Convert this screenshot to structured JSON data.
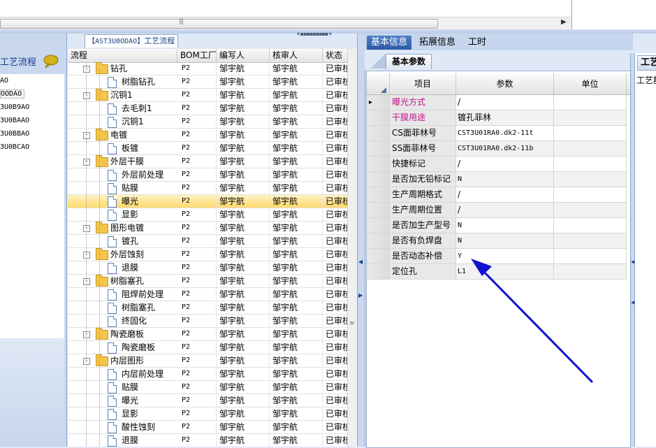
{
  "left_panel": {
    "title": "工艺流程",
    "items": [
      "AO",
      "OODAO",
      "3U0B9AO",
      "3U0BAAO",
      "3U0BBAO",
      "3U0BCAO"
    ],
    "selected_index": 1
  },
  "tree_panel": {
    "tab_code": "【AST3U0ODAO】",
    "tab_label": "工艺流程",
    "columns": [
      "流程",
      "BOM工厂",
      "编写人",
      "核审人",
      "状态"
    ],
    "rows": [
      {
        "name": "钻孔",
        "level": 0,
        "folder": true,
        "expander": "-",
        "bom": "P2",
        "writer": "邹宇航",
        "reviewer": "邹宇航",
        "status": "已审核"
      },
      {
        "name": "树脂钻孔",
        "level": 1,
        "folder": false,
        "bom": "P2",
        "writer": "邹宇航",
        "reviewer": "邹宇航",
        "status": "已审核"
      },
      {
        "name": "沉铜1",
        "level": 0,
        "folder": true,
        "expander": "-",
        "bom": "P2",
        "writer": "邹宇航",
        "reviewer": "邹宇航",
        "status": "已审核"
      },
      {
        "name": "去毛刺1",
        "level": 1,
        "folder": false,
        "bom": "P2",
        "writer": "邹宇航",
        "reviewer": "邹宇航",
        "status": "已审核"
      },
      {
        "name": "沉铜1",
        "level": 1,
        "folder": false,
        "bom": "P2",
        "writer": "邹宇航",
        "reviewer": "邹宇航",
        "status": "已审核"
      },
      {
        "name": "电镀",
        "level": 0,
        "folder": true,
        "expander": "-",
        "bom": "P2",
        "writer": "邹宇航",
        "reviewer": "邹宇航",
        "status": "已审核"
      },
      {
        "name": "板镀",
        "level": 1,
        "folder": false,
        "bom": "P2",
        "writer": "邹宇航",
        "reviewer": "邹宇航",
        "status": "已审核"
      },
      {
        "name": "外层干膜",
        "level": 0,
        "folder": true,
        "expander": "-",
        "bom": "P2",
        "writer": "邹宇航",
        "reviewer": "邹宇航",
        "status": "已审核"
      },
      {
        "name": "外层前处理",
        "level": 1,
        "folder": false,
        "bom": "P2",
        "writer": "邹宇航",
        "reviewer": "邹宇航",
        "status": "已审核"
      },
      {
        "name": "贴膜",
        "level": 1,
        "folder": false,
        "bom": "P2",
        "writer": "邹宇航",
        "reviewer": "邹宇航",
        "status": "已审核"
      },
      {
        "name": "曝光",
        "level": 1,
        "folder": false,
        "selected": true,
        "bom": "P2",
        "writer": "邹宇航",
        "reviewer": "邹宇航",
        "status": "已审核"
      },
      {
        "name": "显影",
        "level": 1,
        "folder": false,
        "bom": "P2",
        "writer": "邹宇航",
        "reviewer": "邹宇航",
        "status": "已审核"
      },
      {
        "name": "图形电镀",
        "level": 0,
        "folder": true,
        "expander": "-",
        "bom": "P2",
        "writer": "邹宇航",
        "reviewer": "邹宇航",
        "status": "已审核"
      },
      {
        "name": "镀孔",
        "level": 1,
        "folder": false,
        "bom": "P2",
        "writer": "邹宇航",
        "reviewer": "邹宇航",
        "status": "已审核"
      },
      {
        "name": "外层蚀刻",
        "level": 0,
        "folder": true,
        "expander": "-",
        "bom": "P2",
        "writer": "邹宇航",
        "reviewer": "邹宇航",
        "status": "已审核"
      },
      {
        "name": "退膜",
        "level": 1,
        "folder": false,
        "bom": "P2",
        "writer": "邹宇航",
        "reviewer": "邹宇航",
        "status": "已审核"
      },
      {
        "name": "树脂塞孔",
        "level": 0,
        "folder": true,
        "expander": "-",
        "bom": "P2",
        "writer": "邹宇航",
        "reviewer": "邹宇航",
        "status": "已审核"
      },
      {
        "name": "阻焊前处理",
        "level": 1,
        "folder": false,
        "bom": "P2",
        "writer": "邹宇航",
        "reviewer": "邹宇航",
        "status": "已审核"
      },
      {
        "name": "树脂塞孔",
        "level": 1,
        "folder": false,
        "bom": "P2",
        "writer": "邹宇航",
        "reviewer": "邹宇航",
        "status": "已审核"
      },
      {
        "name": "终固化",
        "level": 1,
        "folder": false,
        "bom": "P2",
        "writer": "邹宇航",
        "reviewer": "邹宇航",
        "status": "已审核"
      },
      {
        "name": "陶瓷磨板",
        "level": 0,
        "folder": true,
        "expander": "-",
        "bom": "P2",
        "writer": "邹宇航",
        "reviewer": "邹宇航",
        "status": "已审核"
      },
      {
        "name": "陶瓷磨板",
        "level": 1,
        "folder": false,
        "bom": "P2",
        "writer": "邹宇航",
        "reviewer": "邹宇航",
        "status": "已审核"
      },
      {
        "name": "内层图形",
        "level": 0,
        "folder": true,
        "expander": "-",
        "bom": "P2",
        "writer": "邹宇航",
        "reviewer": "邹宇航",
        "status": "已审核"
      },
      {
        "name": "内层前处理",
        "level": 1,
        "folder": false,
        "bom": "P2",
        "writer": "邹宇航",
        "reviewer": "邹宇航",
        "status": "已审核"
      },
      {
        "name": "贴膜",
        "level": 1,
        "folder": false,
        "bom": "P2",
        "writer": "邹宇航",
        "reviewer": "邹宇航",
        "status": "已审核"
      },
      {
        "name": "曝光",
        "level": 1,
        "folder": false,
        "bom": "P2",
        "writer": "邹宇航",
        "reviewer": "邹宇航",
        "status": "已审核"
      },
      {
        "name": "显影",
        "level": 1,
        "folder": false,
        "bom": "P2",
        "writer": "邹宇航",
        "reviewer": "邹宇航",
        "status": "已审核"
      },
      {
        "name": "酸性蚀刻",
        "level": 1,
        "folder": false,
        "bom": "P2",
        "writer": "邹宇航",
        "reviewer": "邹宇航",
        "status": "已审核"
      },
      {
        "name": "退膜",
        "level": 1,
        "folder": false,
        "bom": "P2",
        "writer": "邹宇航",
        "reviewer": "邹宇航",
        "status": "已审核"
      }
    ]
  },
  "info_panel": {
    "tabs": [
      "基本信息",
      "拓展信息",
      "工时"
    ],
    "active_tab": 0,
    "subtab": "基本参数",
    "columns": [
      "项目",
      "参数",
      "单位"
    ],
    "rows": [
      {
        "key": "曝光方式",
        "value": "/",
        "unit": "",
        "pink": true,
        "current": true
      },
      {
        "key": "干膜用途",
        "value": "镀孔菲林",
        "unit": "",
        "pink": true
      },
      {
        "key": "CS面菲林号",
        "value": "CST3U01RA0.dk2-11t",
        "unit": "",
        "mono": true
      },
      {
        "key": "SS面菲林号",
        "value": "CST3U01RA0.dk2-11b",
        "unit": "",
        "mono": true
      },
      {
        "key": "快捷标记",
        "value": "/",
        "unit": ""
      },
      {
        "key": "是否加无铅标记",
        "value": "N",
        "unit": "",
        "mono": true
      },
      {
        "key": "生产周期格式",
        "value": "/",
        "unit": ""
      },
      {
        "key": "生产周期位置",
        "value": "/",
        "unit": ""
      },
      {
        "key": "是否加生产型号",
        "value": "N",
        "unit": "",
        "mono": true
      },
      {
        "key": "是否有负焊盘",
        "value": "N",
        "unit": "",
        "mono": true
      },
      {
        "key": "是否动态补偿",
        "value": "Y",
        "unit": "",
        "mono": true
      },
      {
        "key": "定位孔",
        "value": "L1",
        "unit": "",
        "mono": true
      }
    ]
  },
  "far_right": {
    "tab": "工艺",
    "label": "工艺额"
  },
  "colors": {
    "accent": "#15428b",
    "tab_active": "#2a5aa3",
    "selection": "#ffd96b",
    "pink_key": "#c0138c",
    "annotation_arrow": "#1010d0"
  }
}
